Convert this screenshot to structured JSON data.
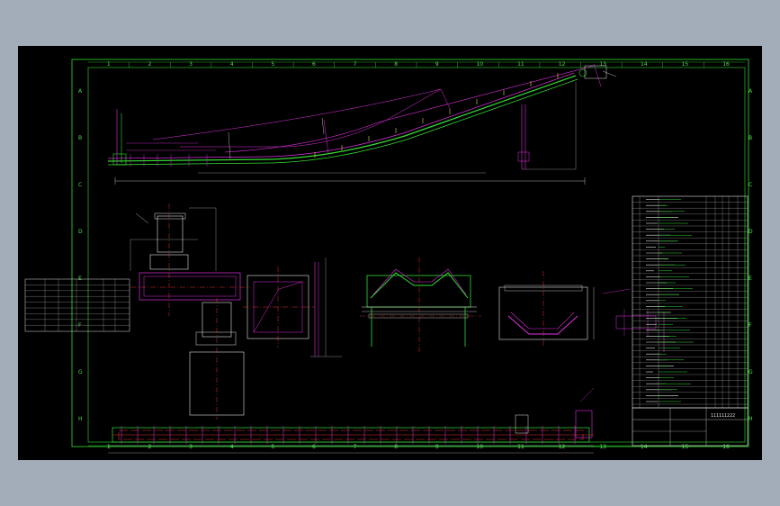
{
  "drawing": {
    "background": "#000000",
    "frame_color": "#33dd33",
    "colors": {
      "green": "#33dd33",
      "magenta": "#e030e0",
      "red": "#e03030",
      "white": "#e0e0e0",
      "yellow": "#e0e030",
      "cyan": "#30d0e0"
    },
    "zone_columns": [
      "1",
      "2",
      "3",
      "4",
      "5",
      "6",
      "7",
      "8",
      "9",
      "10",
      "11",
      "12",
      "13",
      "14",
      "15",
      "16"
    ],
    "zone_rows": [
      "A",
      "B",
      "C",
      "D",
      "E",
      "F",
      "G",
      "H"
    ],
    "title_block_code": "111111222"
  }
}
